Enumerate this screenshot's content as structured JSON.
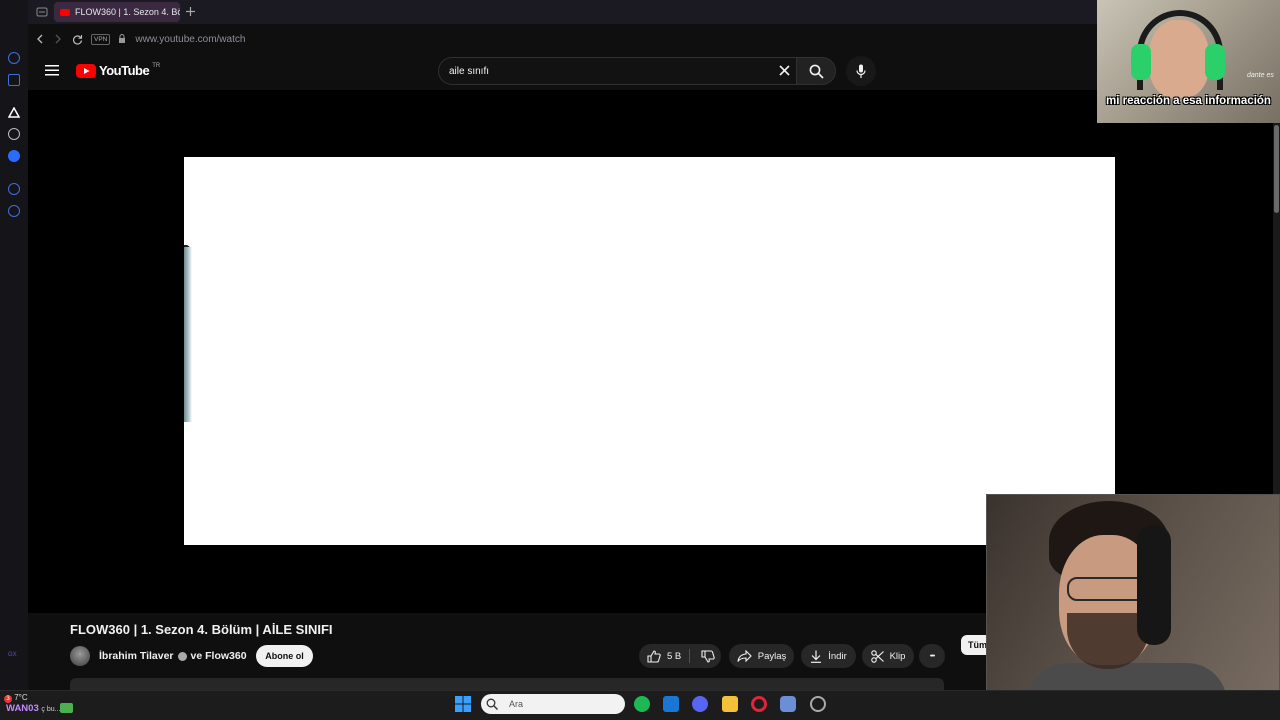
{
  "browser": {
    "tab_title": "FLOW360 | 1. Sezon 4. Bö",
    "url": "www.youtube.com/watch",
    "vpn_label": "VPN"
  },
  "youtube": {
    "logo_text": "YouTube",
    "country_code": "TR",
    "search_value": "aile sınıfı"
  },
  "video": {
    "title": "FLOW360 | 1. Sezon 4. Bölüm | AİLE SINIFI",
    "channel": "İbrahim Tilaver",
    "channel_suffix": "ve Flow360",
    "subscribe_label": "Abone ol",
    "like_count": "5 B",
    "share_label": "Paylaş",
    "download_label": "İndir",
    "clip_label": "Klip",
    "more_label": "•••",
    "chip_label": "Tüm"
  },
  "overlay": {
    "caption": "mi reacción a esa información",
    "corner_text": "dante es"
  },
  "taskbar": {
    "search_placeholder": "Ara",
    "temperature": "7°C",
    "weather_badge": "3",
    "location_text": "WAN03",
    "weather_sub": "ç bu..."
  },
  "colors": {
    "youtube_red": "#ff0000",
    "background": "#0f0f0f",
    "opera_accent": "#3f6fd8"
  }
}
